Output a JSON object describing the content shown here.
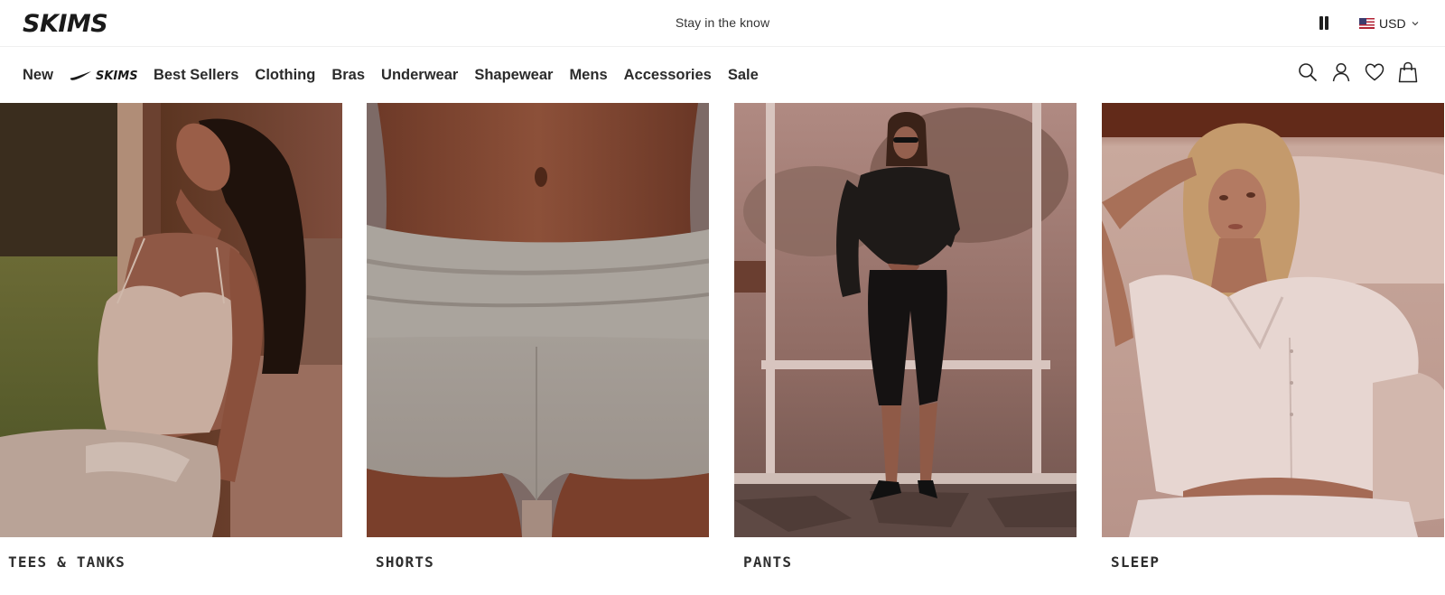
{
  "header": {
    "brand": "SKIMS",
    "announcement": "Stay in the know",
    "currency": "USD",
    "icons": [
      "pause-icon",
      "us-flag-icon",
      "chevron-down-icon"
    ]
  },
  "nav": {
    "items": [
      {
        "label": "New"
      },
      {
        "label": "Nike SKIMS",
        "icon": "nike-skims-logo"
      },
      {
        "label": "Best Sellers"
      },
      {
        "label": "Clothing"
      },
      {
        "label": "Bras"
      },
      {
        "label": "Underwear"
      },
      {
        "label": "Shapewear"
      },
      {
        "label": "Mens"
      },
      {
        "label": "Accessories"
      },
      {
        "label": "Sale"
      }
    ],
    "icons": [
      "search-icon",
      "account-icon",
      "wishlist-heart-icon",
      "shopping-bag-icon"
    ]
  },
  "tiles": [
    {
      "label": "TEES & TANKS"
    },
    {
      "label": "SHORTS"
    },
    {
      "label": "PANTS"
    },
    {
      "label": "SLEEP"
    }
  ],
  "colors": {
    "text": "#2b2b2b",
    "background": "#ffffff",
    "photo_tint": "#8a4a3a"
  }
}
